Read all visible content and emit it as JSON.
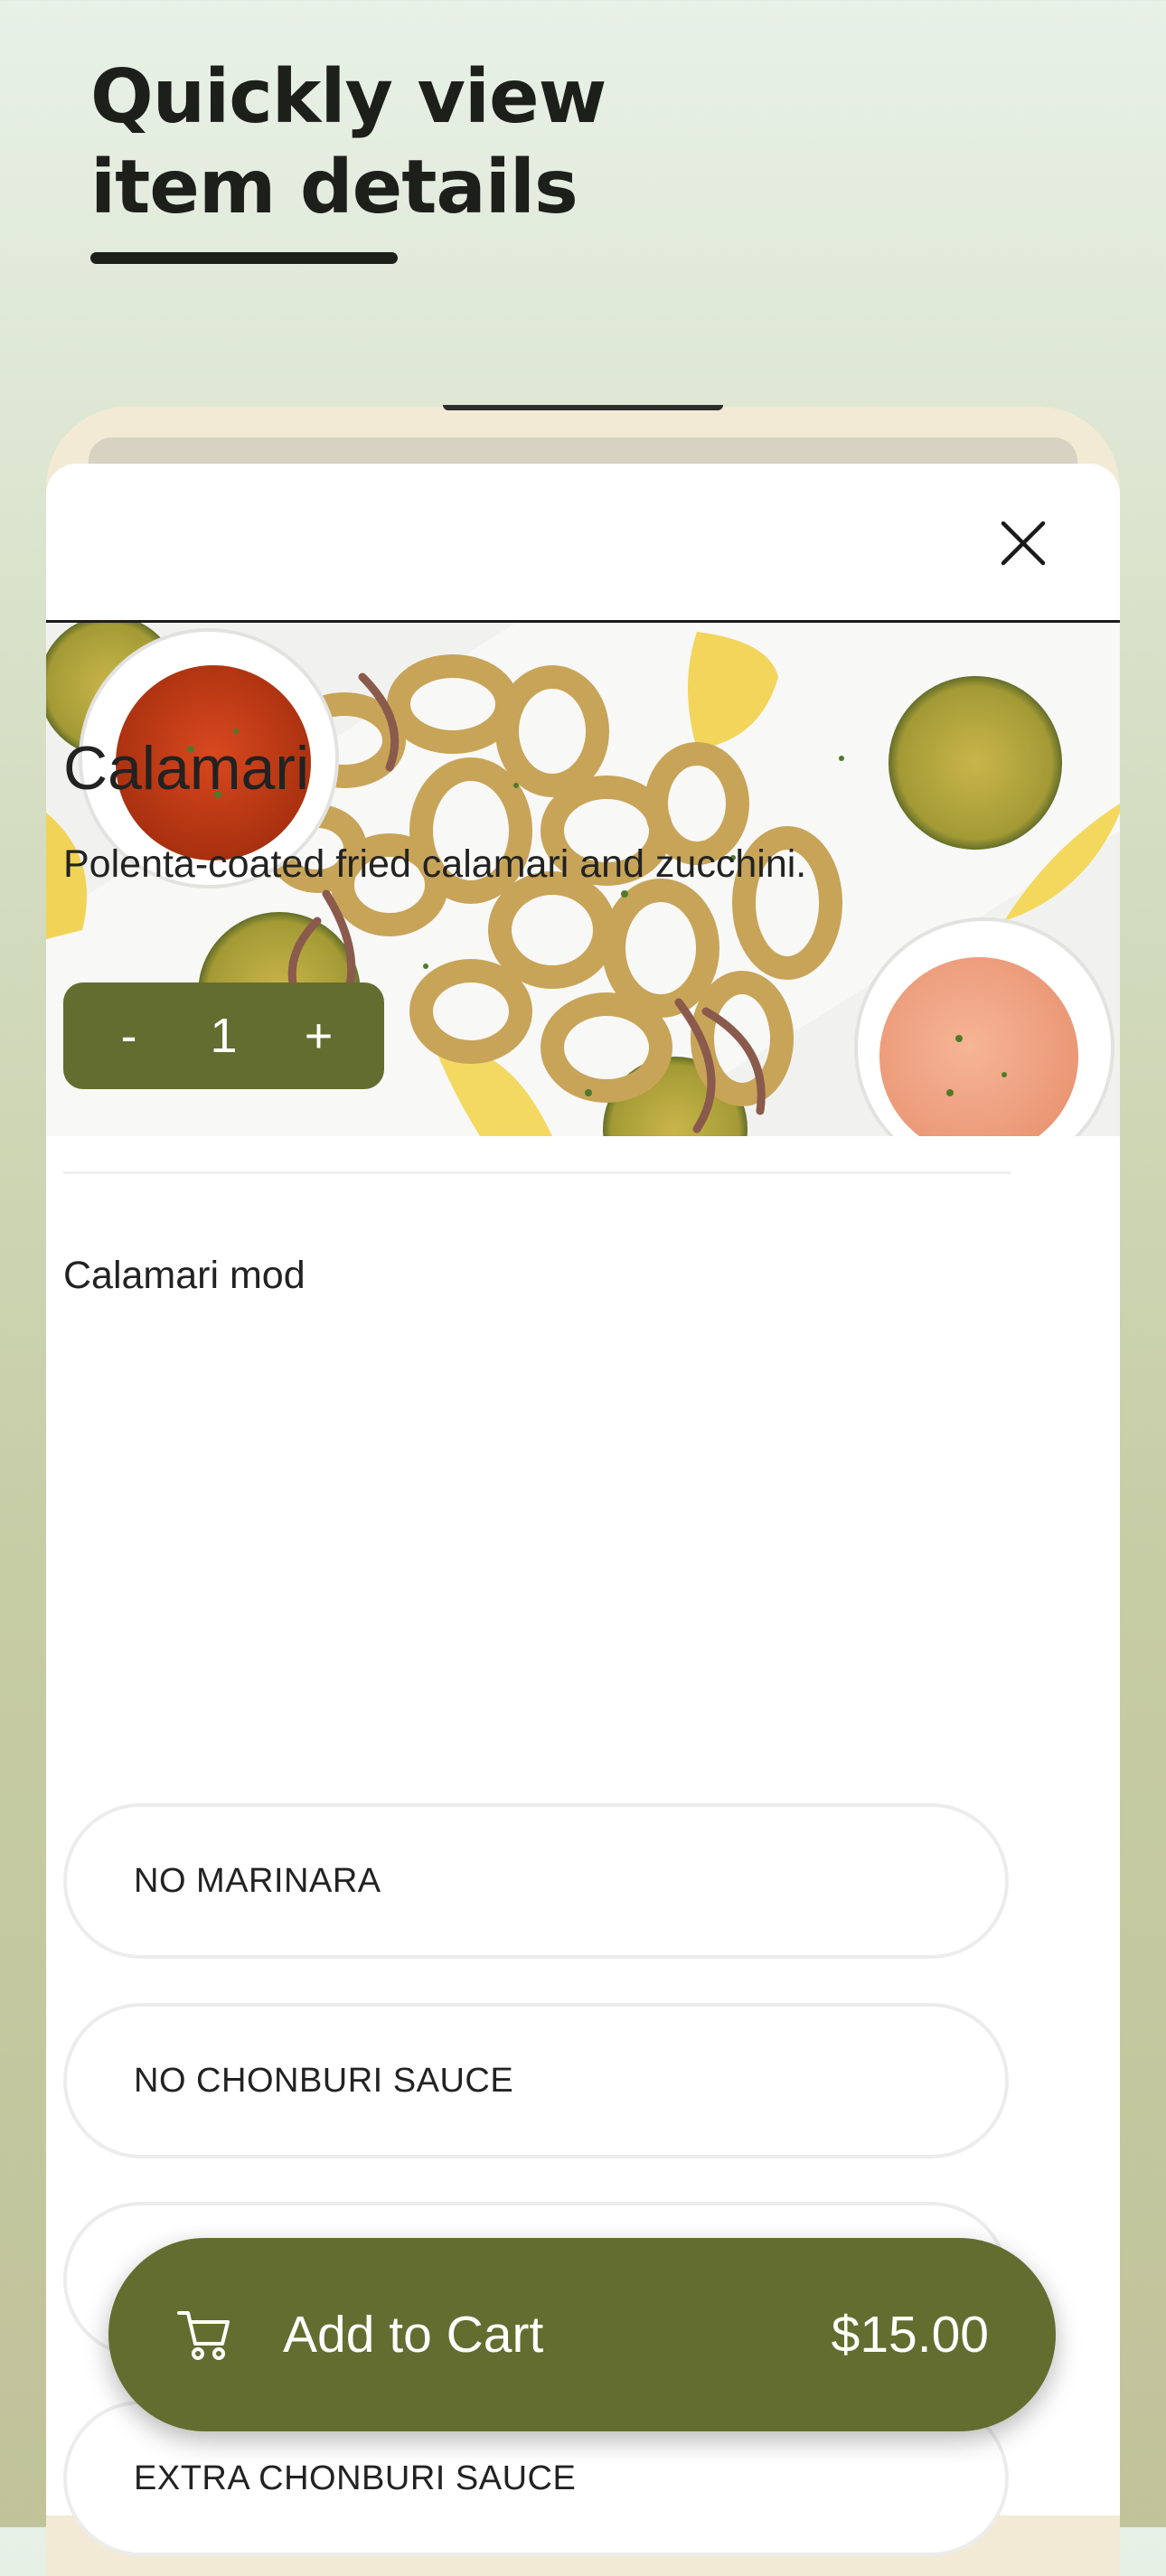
{
  "promo": {
    "headline": "Quickly view item details"
  },
  "item": {
    "name": "Calamari",
    "description": "Polenta-coated fried calamari and zucchini.",
    "image_alt": "Fried calamari with zucchini, lemon wedges and dipping sauces"
  },
  "quantity": {
    "minus_label": "-",
    "value": "1",
    "plus_label": "+"
  },
  "modifiers": {
    "group_title": "Calamari mod",
    "options": [
      {
        "label": "NO MARINARA"
      },
      {
        "label": "NO CHONBURI SAUCE"
      },
      {
        "label": ""
      },
      {
        "label": "EXTRA CHONBURI SAUCE"
      }
    ]
  },
  "cart": {
    "label": "Add to Cart",
    "price": "$15.00"
  },
  "icons": {
    "close": "close-icon",
    "cart": "shopping-cart-icon"
  },
  "colors": {
    "accent": "#636d2f",
    "text": "#222222",
    "sheet": "#ffffff"
  }
}
